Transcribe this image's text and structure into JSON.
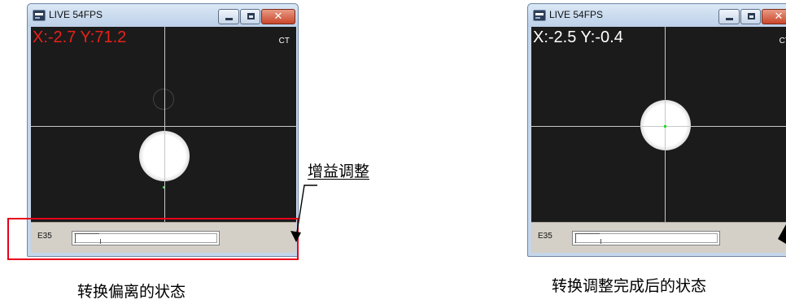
{
  "left_window": {
    "title": "LIVE 54FPS",
    "coord_readout": "X:-2.7 Y:71.2",
    "coord_color": "#e8211a",
    "ct_label": "CT",
    "gain_label": "E35"
  },
  "right_window": {
    "title": "LIVE 54FPS",
    "coord_readout": "X:-2.5 Y:-0.4",
    "coord_color": "#ffffff",
    "ct_label": "CT",
    "gain_label": "E35"
  },
  "annotation": {
    "gain_adjust": "增益调整",
    "highlight_color": "#e8001a"
  },
  "captions": {
    "left": "转换偏离的状态",
    "right": "转换调整完成后的状态"
  },
  "icons": {
    "app": "camera-app-icon",
    "minimize": "minimize-icon",
    "maximize": "maximize-icon",
    "close": "close-icon",
    "arrow": "annotation-arrow-icon"
  }
}
